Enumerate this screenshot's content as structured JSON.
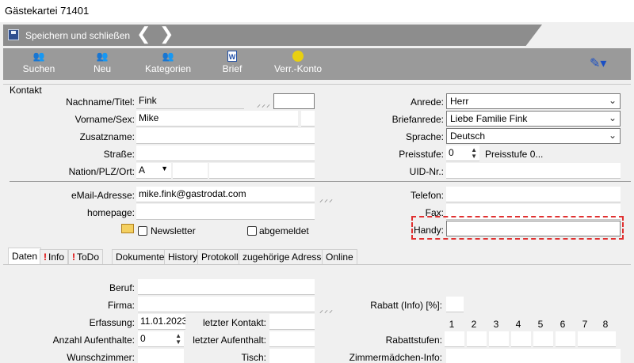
{
  "window": {
    "title": "Gästekartei 71401"
  },
  "quickbar": {
    "save_close_label": "Speichern und schließen",
    "back_glyph": "❮",
    "forward_glyph": "❯"
  },
  "toolbar": {
    "items": [
      {
        "label": "Suchen",
        "icon": "people-search-icon"
      },
      {
        "label": "Neu",
        "icon": "people-add-icon"
      },
      {
        "label": "Kategorien",
        "icon": "people-categories-icon"
      },
      {
        "label": "Brief",
        "icon": "word-document-icon"
      },
      {
        "label": "Verr.-Konto",
        "icon": "coin-icon"
      }
    ],
    "tools_glyph": "✎▾"
  },
  "contact": {
    "group_label": "Kontakt",
    "name_label": "Nachname/Titel:",
    "lastname": "Fink",
    "title_value": "",
    "firstname_label": "Vorname/Sex:",
    "firstname": "Mike",
    "sex": "",
    "suffix_label": "Zusatzname:",
    "suffix": "",
    "street_label": "Straße:",
    "street": "",
    "nation_label": "Nation/PLZ/Ort:",
    "nation": "A",
    "zip": "",
    "city": "",
    "email_label": "eMail-Adresse:",
    "email": "mike.fink@gastrodat.com",
    "homepage_label": "homepage:",
    "homepage": "",
    "newsletter_label": "Newsletter",
    "unsubscribed_label": "abgemeldet",
    "salutation_label": "Anrede:",
    "salutation": "Herr",
    "letter_salutation_label": "Briefanrede:",
    "letter_salutation": "Liebe Familie Fink",
    "language_label": "Sprache:",
    "language": "Deutsch",
    "price_level_label": "Preisstufe:",
    "price_level": "0",
    "price_level_desc": "Preisstufe 0...",
    "vat_label": "UID-Nr.:",
    "vat": "",
    "phone_label": "Telefon:",
    "phone": "",
    "fax_label": "Fax:",
    "fax": "",
    "mobile_label": "Handy:",
    "mobile": "",
    "marks": "⸝⸝⸝"
  },
  "tabs": [
    {
      "label": "Daten",
      "warn": false
    },
    {
      "label": "Info",
      "warn": true
    },
    {
      "label": "ToDo",
      "warn": true
    },
    {
      "label": "Dokumente",
      "warn": false
    },
    {
      "label": "History",
      "warn": false
    },
    {
      "label": "Protokoll",
      "warn": false
    },
    {
      "label": "zugehörige Adressen",
      "warn": false
    },
    {
      "label": "Online",
      "warn": false
    }
  ],
  "data_tab": {
    "job_label": "Beruf:",
    "job": "",
    "company_label": "Firma:",
    "company": "",
    "created_label": "Erfassung:",
    "created": "11.01.2023",
    "last_contact_label": "letzter Kontakt:",
    "last_contact": "",
    "stays_label": "Anzahl Aufenthalte:",
    "stays": "0",
    "last_stay_label": "letzter Aufenthalt:",
    "last_stay": "",
    "room_wish_label": "Wunschzimmer:",
    "room_wish": "",
    "table_label": "Tisch:",
    "table": "",
    "discount_label": "Rabatt (Info) [%]:",
    "discount": "",
    "discount_levels_label": "Rabattstufen:",
    "level_numbers": [
      "1",
      "2",
      "3",
      "4",
      "5",
      "6",
      "7",
      "8"
    ],
    "maid_info_label": "Zimmermädchen-Info:",
    "maid_info": ""
  }
}
